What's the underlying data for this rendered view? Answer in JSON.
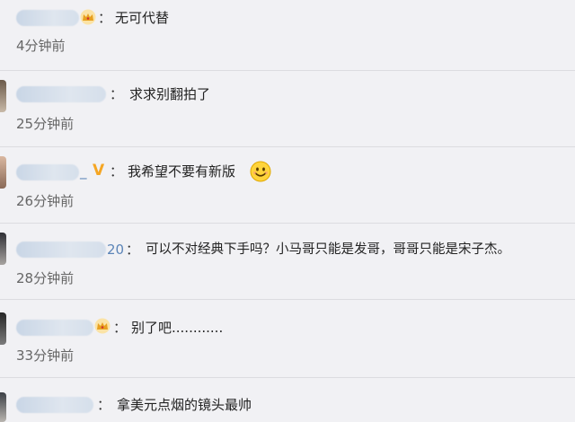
{
  "comments": [
    {
      "username_tail": "",
      "badge": "crown",
      "text": "无可代替",
      "time": "4分钟前"
    },
    {
      "username_tail": "",
      "badge": "",
      "text": "求求别翻拍了",
      "time": "25分钟前"
    },
    {
      "username_tail": "_",
      "badge": "v",
      "badge_text": "V",
      "text": "我希望不要有新版",
      "emoji": "smiley-face-icon",
      "time": "26分钟前"
    },
    {
      "username_tail": "20",
      "badge": "",
      "text": "可以不对经典下手吗？小马哥只能是发哥，哥哥只能是宋子杰。",
      "time": "28分钟前"
    },
    {
      "username_tail": "",
      "badge": "crown",
      "text": "别了吧............",
      "time": "33分钟前"
    },
    {
      "username_tail": "",
      "badge": "",
      "text": "拿美元点烟的镜头最帅",
      "time": ""
    }
  ],
  "colon": "：",
  "colors": {
    "background": "#f1f1f4",
    "divider": "#dcdce0",
    "username": "#5c85b8",
    "vip_badge": "#f5a623",
    "crown": "#e8a020"
  }
}
